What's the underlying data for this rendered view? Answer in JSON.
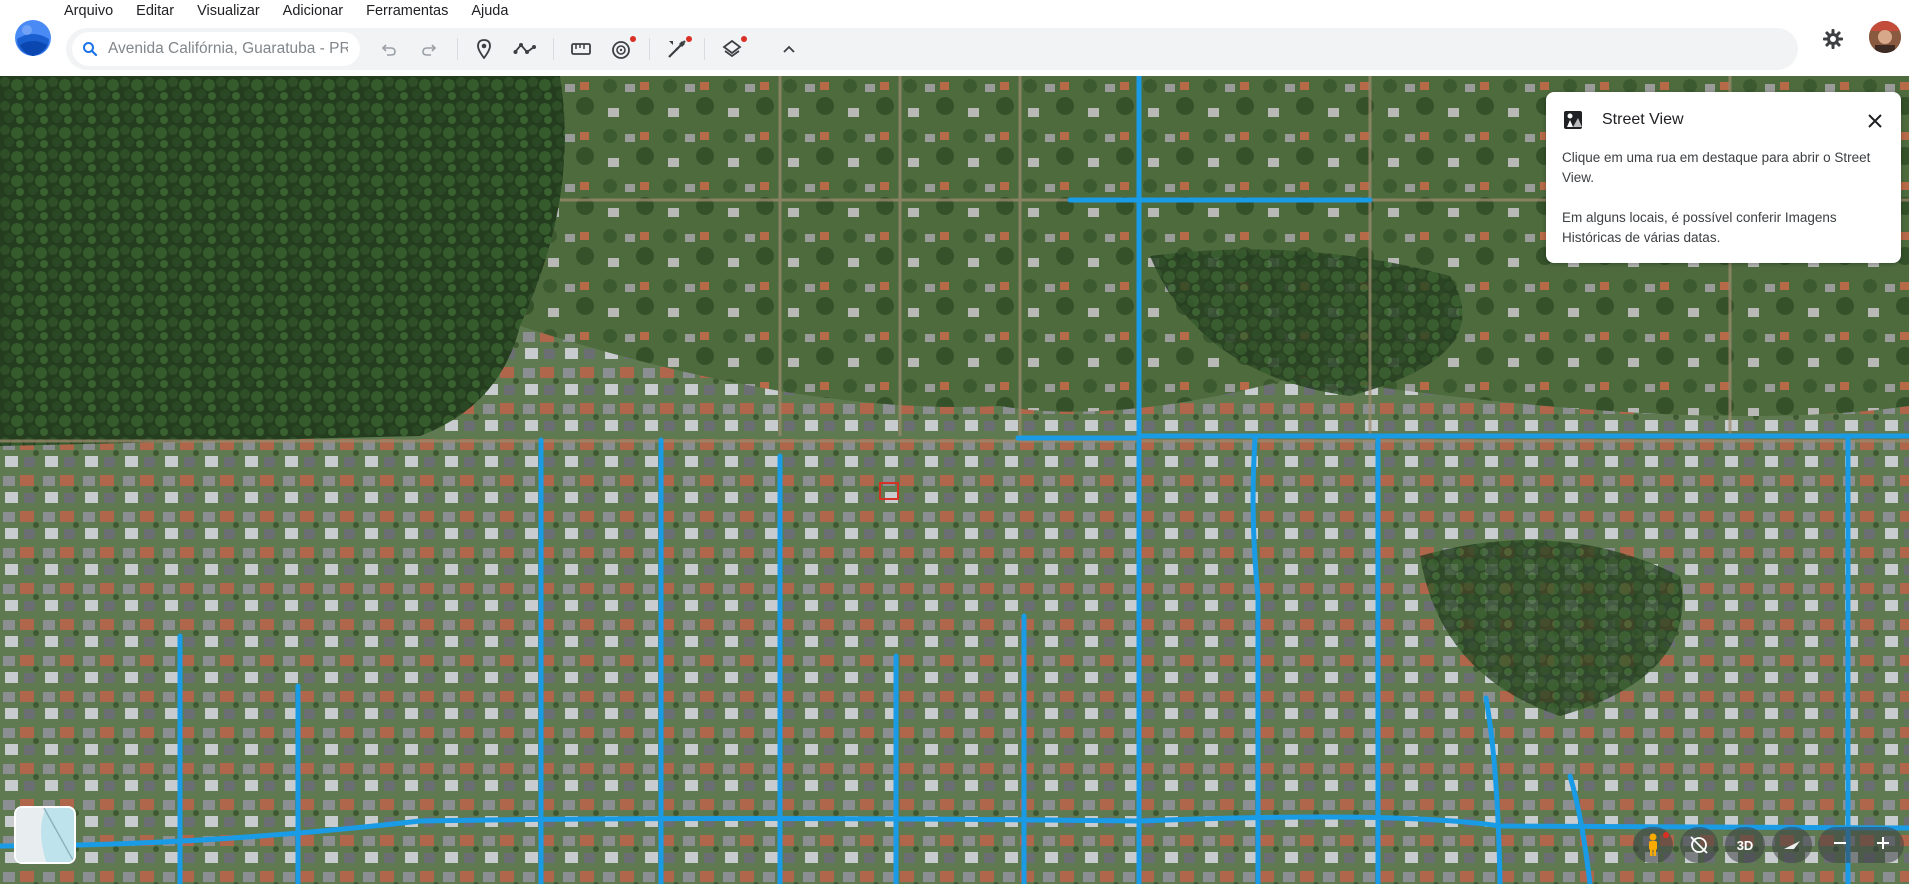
{
  "menu": {
    "items": [
      "Arquivo",
      "Editar",
      "Visualizar",
      "Adicionar",
      "Ferramentas",
      "Ajuda"
    ]
  },
  "search": {
    "value": "",
    "placeholder": "Avenida Califórnia, Guaratuba - PR"
  },
  "toolbar": {
    "icons": [
      "undo-icon",
      "redo-icon",
      "placemark-icon",
      "path-icon",
      "ruler-icon",
      "historical-imagery-icon",
      "tools-icon",
      "layers-icon",
      "collapse-icon"
    ]
  },
  "street_view_panel": {
    "title": "Street View",
    "paragraph_1": "Clique em uma rua em destaque para abrir o Street View.",
    "paragraph_2": "Em alguns locais, é possível conferir Imagens Históricas de várias datas."
  },
  "map_controls": {
    "view_3d_label": "3D"
  },
  "colors": {
    "street_highlight": "#1a9be6",
    "accent_blue": "#1a73e8",
    "notification_dot": "#d93025"
  }
}
